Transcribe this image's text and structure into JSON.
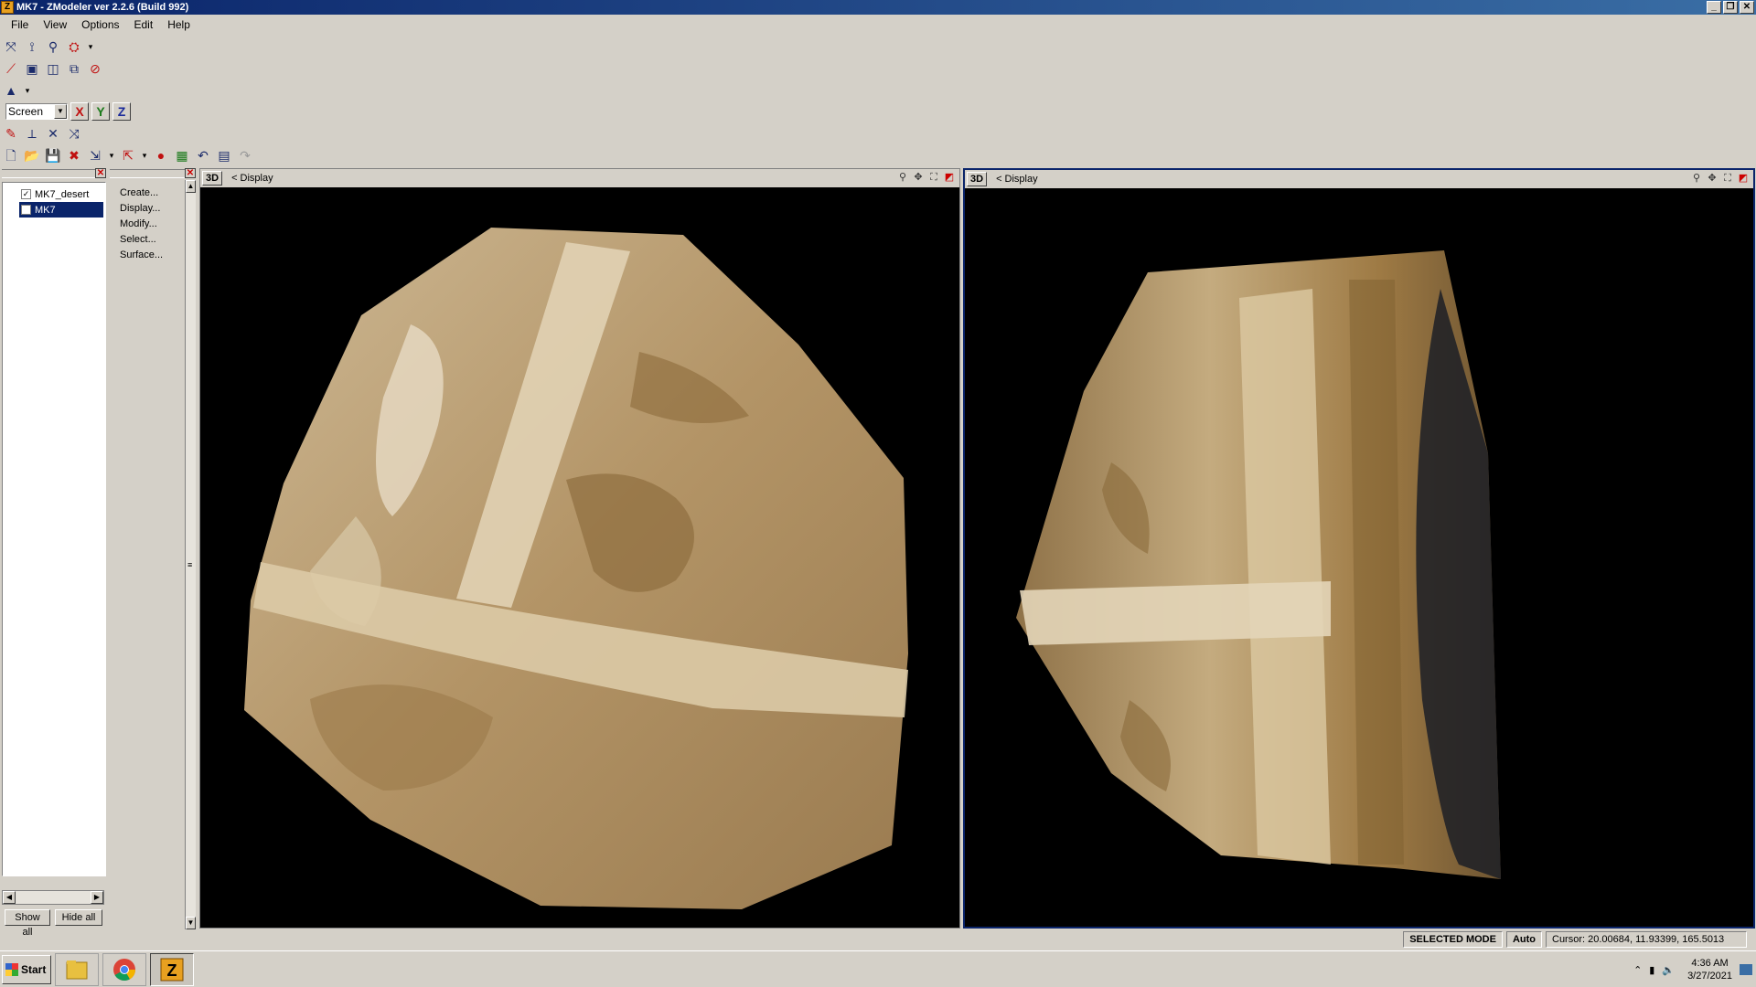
{
  "window": {
    "title": "MK7 - ZModeler ver 2.2.6 (Build 992)",
    "app_icon": "Z",
    "controls": {
      "minimize": "_",
      "restore": "❐",
      "close": "✕"
    }
  },
  "menubar": {
    "items": [
      "File",
      "View",
      "Options",
      "Edit",
      "Help"
    ]
  },
  "toolbar": {
    "coord_system": "Screen",
    "axes": {
      "x": "X",
      "y": "Y",
      "z": "Z"
    },
    "axis_colors": {
      "x": "#c01010",
      "y": "#1a7a1a",
      "z": "#1a2a9a"
    }
  },
  "object_tree": {
    "items": [
      {
        "label": "MK7_desert",
        "checked": "✓",
        "selected": false
      },
      {
        "label": "MK7",
        "checked": "",
        "selected": true
      }
    ],
    "show_all_label": "Show all",
    "hide_all_label": "Hide all"
  },
  "command_panel": {
    "items": [
      "Create...",
      "Display...",
      "Modify...",
      "Select...",
      "Surface..."
    ]
  },
  "viewports": [
    {
      "tag": "3D",
      "label": "<  Display"
    },
    {
      "tag": "3D",
      "label": "<  Display"
    }
  ],
  "statusbar": {
    "mode": "SELECTED MODE",
    "auto": "Auto",
    "cursor": "Cursor: 20.00684, 11.93399, 165.5013"
  },
  "taskbar": {
    "start_label": "Start",
    "clock_time": "4:36 AM",
    "clock_date": "3/27/2021"
  },
  "colors": {
    "title_gradient_start": "#0a246a",
    "title_gradient_end": "#3a6ea5",
    "selection": "#0a246a",
    "chrome": "#d4d0c8"
  }
}
